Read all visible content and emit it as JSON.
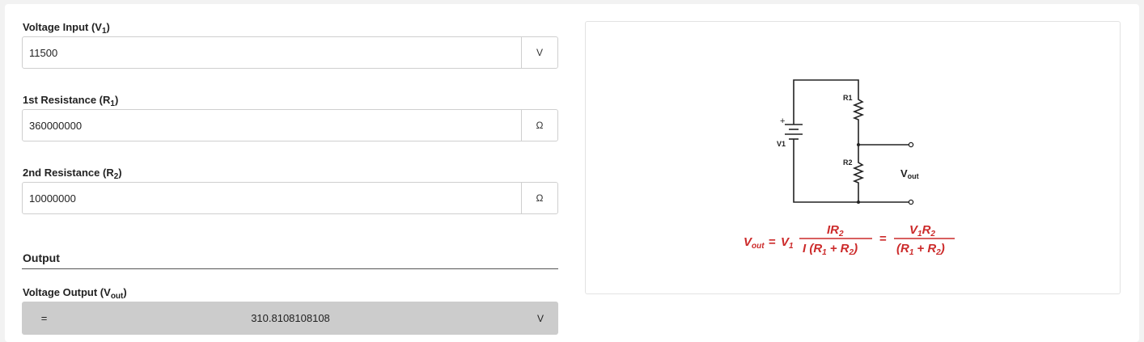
{
  "inputs": [
    {
      "label": "Voltage Input (V",
      "sub": "1",
      "close": ")",
      "value": "11500",
      "unit": "V"
    },
    {
      "label": "1st Resistance (R",
      "sub": "1",
      "close": ")",
      "value": "360000000",
      "unit": "Ω"
    },
    {
      "label": "2nd Resistance (R",
      "sub": "2",
      "close": ")",
      "value": "10000000",
      "unit": "Ω"
    }
  ],
  "output": {
    "section_title": "Output",
    "label": "Voltage Output (V",
    "sub": "out",
    "close": ")",
    "prefix": "=",
    "value": "310.8108108108",
    "unit": "V"
  },
  "diagram": {
    "labels": {
      "r1": "R1",
      "r2": "R2",
      "v1": "V1",
      "plus": "+",
      "vout_main": "V",
      "vout_sub": "out"
    },
    "formula": {
      "lhs_main": "V",
      "lhs_sub": "out",
      "eq1": "=",
      "v1_main": "V",
      "v1_sub": "1",
      "frac1_num_main": "IR",
      "frac1_num_sub": "2",
      "frac1_den_a": "I (R",
      "frac1_den_sub1": "1",
      "frac1_den_b": "+ R",
      "frac1_den_sub2": "2",
      "frac1_den_c": ")",
      "eq2": "=",
      "frac2_num_a": "V",
      "frac2_num_sub1": "1",
      "frac2_num_b": "R",
      "frac2_num_sub2": "2",
      "frac2_den_a": "(R",
      "frac2_den_sub1": "1",
      "frac2_den_b": "+ R",
      "frac2_den_sub2": "2",
      "frac2_den_c": ")"
    },
    "formula_color": "#cc2a2a"
  }
}
